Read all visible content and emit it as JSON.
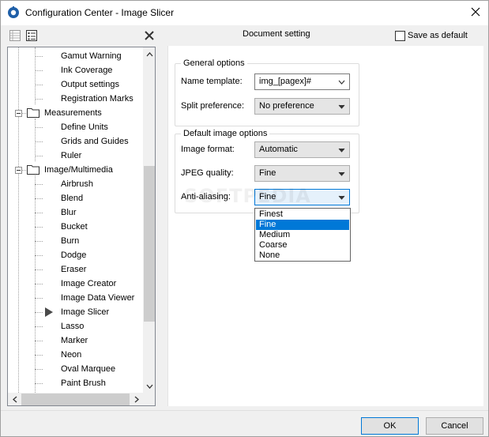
{
  "window": {
    "title": "Configuration Center - Image Slicer",
    "app_icon": "gear-app-icon",
    "close_icon": "close-icon"
  },
  "left_toolbar": {
    "icons": [
      "panel-icon",
      "list-icon",
      "close-x-icon"
    ]
  },
  "tree": {
    "items": [
      {
        "label": "Gamut Warning",
        "type": "leaf"
      },
      {
        "label": "Ink Coverage",
        "type": "leaf"
      },
      {
        "label": "Output settings",
        "type": "leaf"
      },
      {
        "label": "Registration Marks",
        "type": "leaf"
      },
      {
        "label": "Measurements",
        "type": "folder"
      },
      {
        "label": "Define Units",
        "type": "leaf"
      },
      {
        "label": "Grids and Guides",
        "type": "leaf"
      },
      {
        "label": "Ruler",
        "type": "leaf"
      },
      {
        "label": "Image/Multimedia",
        "type": "folder"
      },
      {
        "label": "Airbrush",
        "type": "leaf"
      },
      {
        "label": "Blend",
        "type": "leaf"
      },
      {
        "label": "Blur",
        "type": "leaf"
      },
      {
        "label": "Bucket",
        "type": "leaf"
      },
      {
        "label": "Burn",
        "type": "leaf"
      },
      {
        "label": "Dodge",
        "type": "leaf"
      },
      {
        "label": "Eraser",
        "type": "leaf"
      },
      {
        "label": "Image Creator",
        "type": "leaf"
      },
      {
        "label": "Image Data Viewer",
        "type": "leaf"
      },
      {
        "label": "Image Slicer",
        "type": "leaf",
        "selected": true
      },
      {
        "label": "Lasso",
        "type": "leaf"
      },
      {
        "label": "Marker",
        "type": "leaf"
      },
      {
        "label": "Neon",
        "type": "leaf"
      },
      {
        "label": "Oval Marquee",
        "type": "leaf"
      },
      {
        "label": "Paint Brush",
        "type": "leaf"
      }
    ]
  },
  "header": {
    "section_title": "Document setting",
    "save_default_label": "Save as default",
    "save_default_checked": false
  },
  "general": {
    "title": "General options",
    "name_template_label": "Name template:",
    "name_template_value": "img_[pagex]#",
    "split_label": "Split preference:",
    "split_value": "No preference"
  },
  "image_options": {
    "title": "Default image options",
    "format_label": "Image format:",
    "format_value": "Automatic",
    "jpeg_label": "JPEG quality:",
    "jpeg_value": "Fine",
    "aa_label": "Anti-aliasing:",
    "aa_value": "Fine"
  },
  "dropdown": {
    "options": [
      "Finest",
      "Fine",
      "Medium",
      "Coarse",
      "None"
    ],
    "selected_index": 1
  },
  "watermark": "SOFTPEDIA",
  "footer": {
    "ok_label": "OK",
    "cancel_label": "Cancel"
  },
  "colors": {
    "accent": "#0078d7"
  }
}
